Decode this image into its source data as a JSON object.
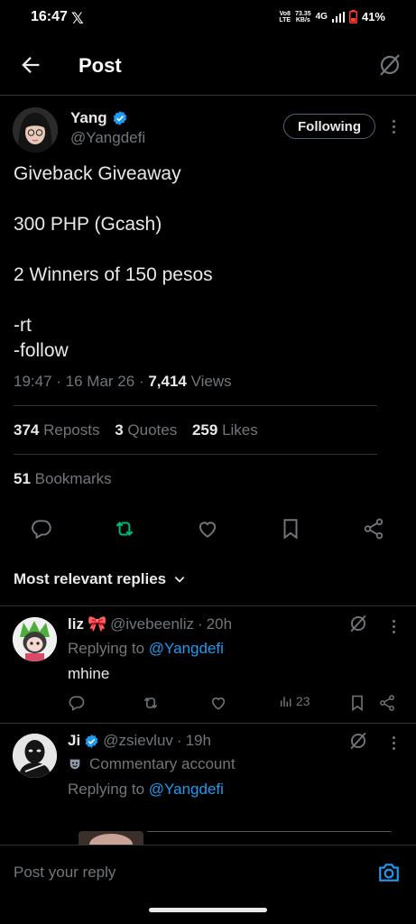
{
  "status_bar": {
    "time": "16:47",
    "app_icon": "x-logo",
    "volte": "Vo8\nLTE",
    "speed": "73.35\nKB/s",
    "network": "4G",
    "battery": "41%"
  },
  "header": {
    "title": "Post",
    "back_icon": "arrow-left-icon",
    "grok_icon": "grok-icon"
  },
  "post": {
    "author_name": "Yang",
    "handle": "@Yangdefi",
    "follow_label": "Following",
    "lines": [
      "Giveback Giveaway",
      "300 PHP (Gcash)",
      "2 Winners of 150 pesos",
      "-rt",
      "-follow"
    ],
    "time": "19:47",
    "date": "16 Mar 26",
    "views_count": "7,414",
    "views_label": "Views",
    "reposts_count": "374",
    "reposts_label": "Reposts",
    "quotes_count": "3",
    "quotes_label": "Quotes",
    "likes_count": "259",
    "likes_label": "Likes",
    "bookmarks_count": "51",
    "bookmarks_label": "Bookmarks"
  },
  "sort_label": "Most relevant replies",
  "replies": [
    {
      "name": "liz",
      "emoji": "🎀",
      "handle": "@ivebeenliz",
      "age": "20h",
      "replying_prefix": "Replying to",
      "replying_to": "@Yangdefi",
      "text": "mhine",
      "views": "23"
    },
    {
      "name": "Ji",
      "handle": "@zsievluv",
      "age": "19h",
      "badge": "Commentary account",
      "replying_prefix": "Replying to",
      "replying_to": "@Yangdefi"
    }
  ],
  "compose": {
    "placeholder": "Post your reply"
  },
  "colors": {
    "background": "#000000",
    "accent": "#1d9bf0",
    "repost_active": "#00ba7c",
    "muted": "#71767b",
    "divider": "#2f3336"
  }
}
